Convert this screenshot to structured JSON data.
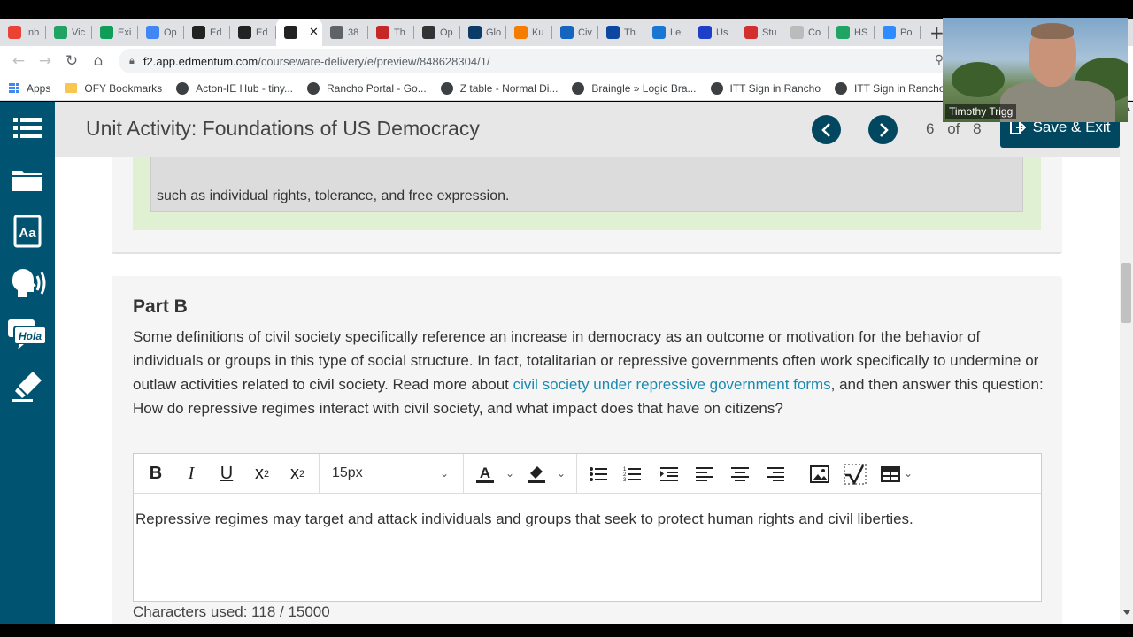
{
  "browser": {
    "tabs": [
      {
        "label": "Inb",
        "icon": "gmail-icon",
        "color": "#ea4335"
      },
      {
        "label": "Vic",
        "icon": "drive-icon",
        "color": "#1fa463"
      },
      {
        "label": "Exi",
        "icon": "sheets-icon",
        "color": "#0f9d58"
      },
      {
        "label": "Op",
        "icon": "calendar-icon",
        "color": "#4285f4"
      },
      {
        "label": "Ed",
        "icon": "edmentum-icon",
        "color": "#222222"
      },
      {
        "label": "Ed",
        "icon": "edmentum-icon",
        "color": "#222222"
      },
      {
        "label": "",
        "icon": "edmentum-icon",
        "color": "#222222",
        "active": true
      },
      {
        "label": "38",
        "icon": "globe-icon",
        "color": "#5f6368"
      },
      {
        "label": "Th",
        "icon": "site-icon",
        "color": "#c62828"
      },
      {
        "label": "Op",
        "icon": "society-icon",
        "color": "#333333"
      },
      {
        "label": "Glo",
        "icon": "un-icon",
        "color": "#0b3c68"
      },
      {
        "label": "Ku",
        "icon": "site-icon",
        "color": "#f57c00"
      },
      {
        "label": "Civ",
        "icon": "britannica-icon",
        "color": "#1565c0"
      },
      {
        "label": "Th",
        "icon": "n-icon",
        "color": "#0d47a1"
      },
      {
        "label": "Le",
        "icon": "site-icon",
        "color": "#1976d2"
      },
      {
        "label": "Us",
        "icon": "play-icon",
        "color": "#1e40c8"
      },
      {
        "label": "Stu",
        "icon": "apple-icon",
        "color": "#d32f2f"
      },
      {
        "label": "Co",
        "icon": "site-icon",
        "color": "#bbbbbb"
      },
      {
        "label": "HS",
        "icon": "drive-icon",
        "color": "#1fa463"
      },
      {
        "label": "Po",
        "icon": "zoom-icon",
        "color": "#2d8cff"
      }
    ],
    "url_host": "f2.app.edmentum.com",
    "url_path": "/courseware-delivery/e/preview/848628304/1/",
    "bookmarks": [
      {
        "label": "Apps",
        "type": "grid"
      },
      {
        "label": "OFY Bookmarks",
        "type": "folder"
      },
      {
        "label": "Acton-IE Hub - tiny...",
        "type": "site"
      },
      {
        "label": "Rancho Portal - Go...",
        "type": "site"
      },
      {
        "label": "Z table - Normal Di...",
        "type": "site"
      },
      {
        "label": "Braingle » Logic Bra...",
        "type": "site"
      },
      {
        "label": "ITT Sign in Rancho",
        "type": "site"
      },
      {
        "label": "ITT Sign in Rancho (...",
        "type": "site"
      }
    ]
  },
  "header": {
    "title": "Unit Activity: Foundations of US Democracy",
    "page_current": "6",
    "page_of": "of",
    "page_total": "8",
    "save_exit": "Save & Exit"
  },
  "part_a": {
    "tail_text": "such as individual rights, tolerance, and free expression."
  },
  "part_b": {
    "heading": "Part B",
    "question_before": "Some definitions of civil society specifically reference an increase in democracy as an outcome or motivation for the behavior of individuals or groups in this type of social structure. In fact, totalitarian or repressive governments often work specifically to undermine or outlaw activities related to civil society. Read more about ",
    "link_text": "civil society under repressive government forms",
    "question_after": ", and then answer this question: How do repressive regimes interact with civil society, and what impact does that have on citizens?",
    "font_size": "15px",
    "answer": "Repressive regimes may target and attack individuals and groups that seek to protect human rights and civil liberties.",
    "chars_used": "Characters used: 118 / 15000"
  },
  "webcam": {
    "name": "Timothy Trigg"
  }
}
